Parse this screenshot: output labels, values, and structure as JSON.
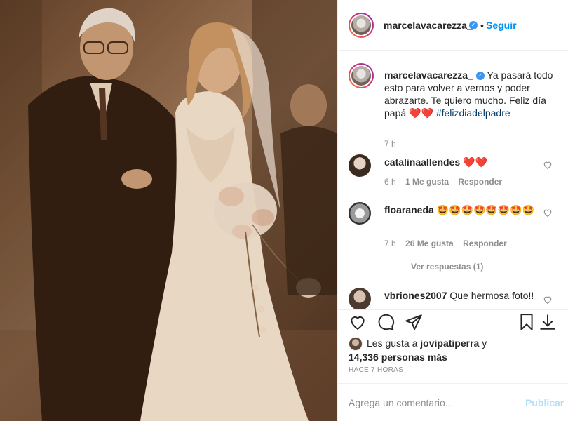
{
  "post": {
    "author": "marcelavacarezza_",
    "follow_label": "Seguir",
    "separator": "•",
    "verified_glyph": "✓"
  },
  "caption": {
    "author": "marcelavacarezza_",
    "text": "Ya pasará todo esto para volver a vernos y poder abrazarte. Te quiero mucho. Feliz día papá",
    "hearts": "❤️❤️",
    "hashtag": "#felizdiadelpadre",
    "time": "7 h"
  },
  "comments": [
    {
      "user": "catalinaallendes",
      "text": "❤️❤️",
      "time": "6 h",
      "likes": "1 Me gusta",
      "reply": "Responder"
    },
    {
      "user": "floaraneda",
      "text": "🤩🤩🤩🤩🤩🤩🤩🤩",
      "time": "7 h",
      "likes": "26 Me gusta",
      "reply": "Responder"
    },
    {
      "user": "vbriones2007",
      "text": "Que hermosa foto!!"
    }
  ],
  "view_replies": "Ver respuestas (1)",
  "likes": {
    "prefix": "Les gusta a",
    "user": "jovipatiperra",
    "conj": "y",
    "count": "14,336 personas más"
  },
  "time_ago": "HACE 7 HORAS",
  "comment_box": {
    "placeholder": "Agrega un comentario...",
    "post_label": "Publicar"
  },
  "icons": [
    "heart-icon",
    "comment-icon",
    "share-icon",
    "bookmark-icon",
    "download-icon"
  ]
}
